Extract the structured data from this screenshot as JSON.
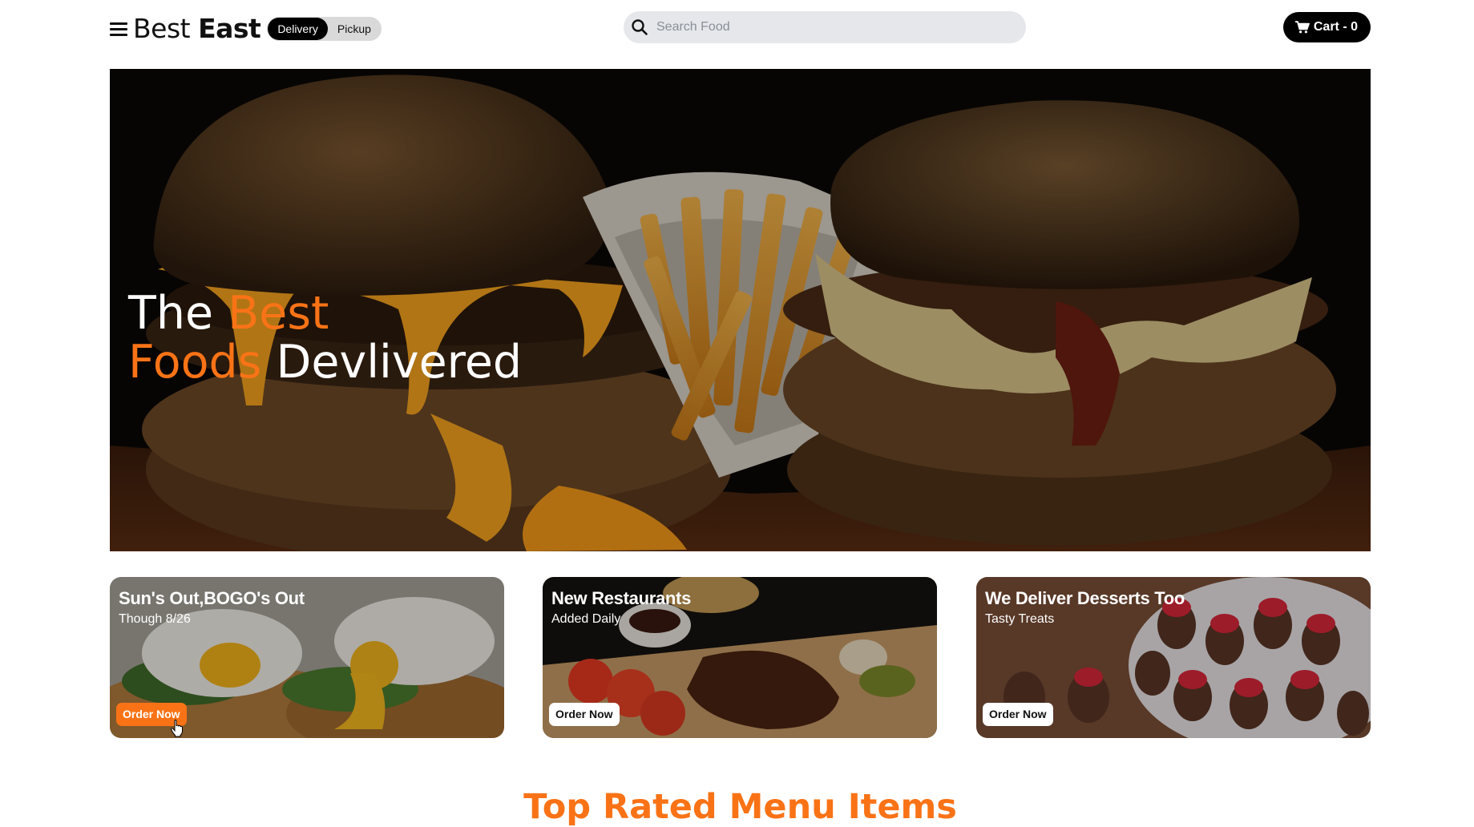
{
  "header": {
    "logo_part1": "Best",
    "logo_part2": "East",
    "toggle": [
      "Delivery",
      "Pickup"
    ],
    "search_placeholder": "Search Food",
    "cart_label": "Cart - 0"
  },
  "hero": {
    "title_white1": "The ",
    "title_orange1": "Best",
    "title_orange2": "Foods",
    "title_white2": " Devlivered"
  },
  "cards": [
    {
      "title": "Sun's Out,BOGO's Out",
      "subtitle": "Though 8/26",
      "button": "Order Now"
    },
    {
      "title": "New Restaurants",
      "subtitle": "Added Daily",
      "button": "Order Now"
    },
    {
      "title": "We Deliver Desserts Too",
      "subtitle": "Tasty Treats",
      "button": "Order Now"
    }
  ],
  "section_title": "Top Rated Menu Items",
  "colors": {
    "accent": "#f97316",
    "dark": "#000000",
    "search_bg": "#e5e7eb"
  },
  "icons": [
    "menu-icon",
    "search-icon",
    "cart-icon",
    "pointer-cursor-icon"
  ]
}
